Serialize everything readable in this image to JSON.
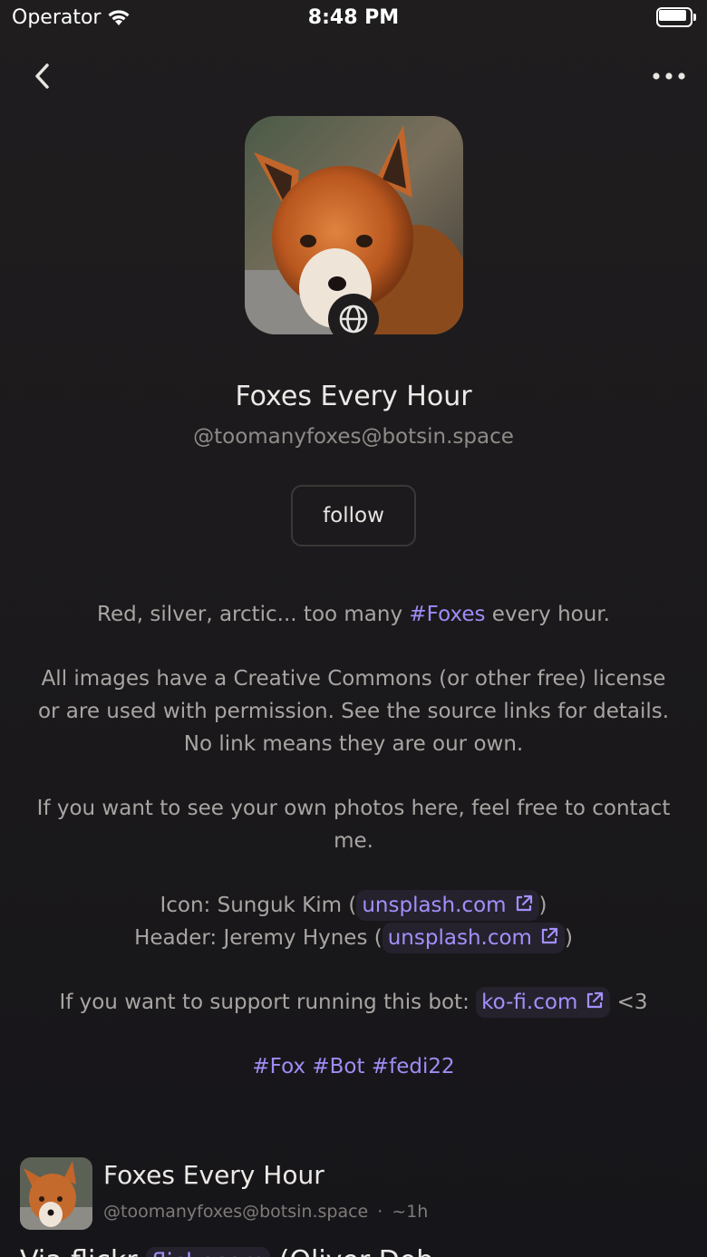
{
  "status_bar": {
    "carrier": "Operator",
    "time": "8:48 PM"
  },
  "nav": {
    "back_icon": "chevron-left-icon",
    "more_icon": "ellipsis-icon"
  },
  "profile": {
    "display_name": "Foxes Every Hour",
    "handle": "@toomanyfoxes@botsin.space",
    "follow_label": "follow",
    "badge_icon": "globe-icon"
  },
  "bio": {
    "line1_pre": "Red, silver, arctic... too many ",
    "line1_tag": "#Foxes",
    "line1_post": " every hour.",
    "paragraph2": "All images have a Creative Commons (or other free) license or are used with permission. See the source links for details. No link means they are our own.",
    "paragraph3": "If you want to see your own photos here, feel free to contact me.",
    "icon_credit_pre": "Icon: Sunguk Kim (",
    "icon_credit_link": "unsplash.com",
    "icon_credit_post": ")",
    "header_credit_pre": "Header: Jeremy Hynes (",
    "header_credit_link": "unsplash.com",
    "header_credit_post": ")",
    "support_pre": "If you want to support running this bot: ",
    "support_link": "ko-fi.com",
    "support_post": " <3",
    "tag1": "#Fox",
    "tag2": "#Bot",
    "tag3": "#fedi22"
  },
  "post": {
    "author": "Foxes Every Hour",
    "handle": "@toomanyfoxes@botsin.space",
    "separator": "·",
    "time": "~1h",
    "body_pre": "Via flickr ",
    "body_link": "flickr.com",
    "body_post": " (Oliver Dob..."
  }
}
